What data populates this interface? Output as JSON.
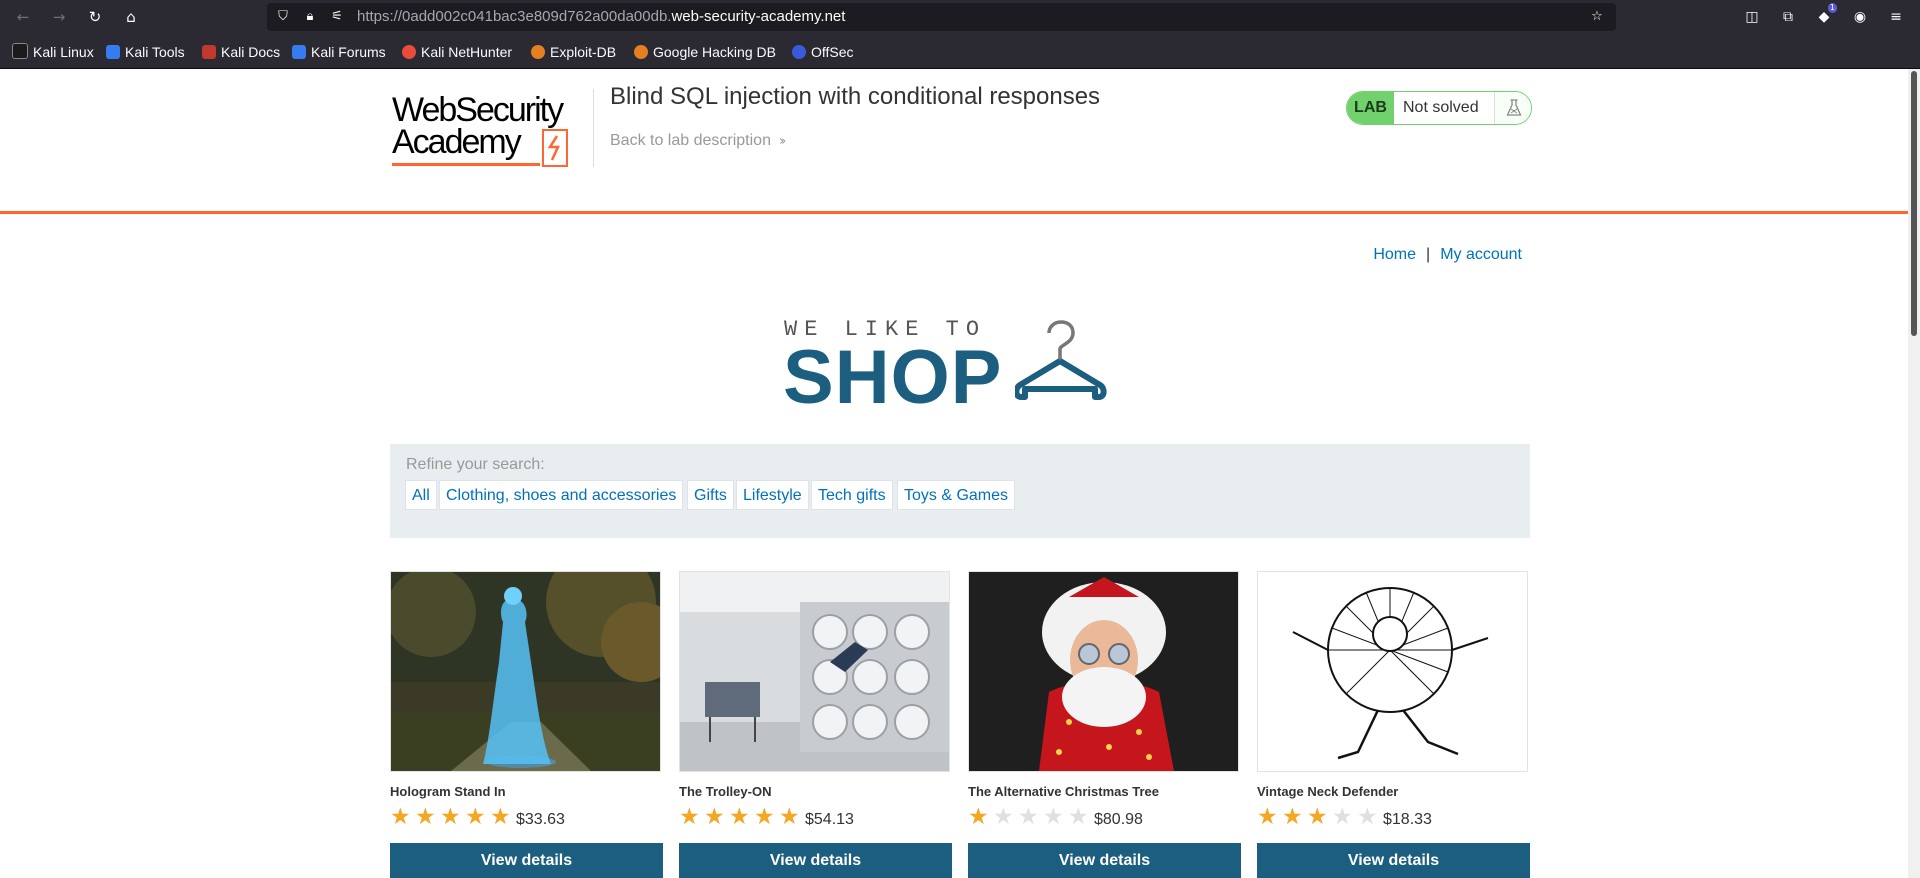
{
  "browser": {
    "url_prefix": "https://0add002c041bac3e809d762a00da00db.",
    "url_domain": "web-security-academy.net",
    "extension_badge": "1",
    "bookmarks": [
      {
        "label": "Kali Linux",
        "color": "#1b1b1b"
      },
      {
        "label": "Kali Tools",
        "color": "#367bf0"
      },
      {
        "label": "Kali Docs",
        "color": "#c0392b"
      },
      {
        "label": "Kali Forums",
        "color": "#367bf0"
      },
      {
        "label": "Kali NetHunter",
        "color": "#e74c3c"
      },
      {
        "label": "Exploit-DB",
        "color": "#e67e22"
      },
      {
        "label": "Google Hacking DB",
        "color": "#e67e22"
      },
      {
        "label": "OffSec",
        "color": "#3a5bd9"
      }
    ]
  },
  "lab": {
    "logo_line1": "WebSecurity",
    "logo_line2": "Academy",
    "title": "Blind SQL injection with conditional responses",
    "back_link": "Back to lab description",
    "status_tag": "LAB",
    "status_text": "Not solved"
  },
  "nav": {
    "home": "Home",
    "separator": "|",
    "my_account": "My account"
  },
  "banner": {
    "tagline": "WE LIKE TO",
    "word": "SHOP"
  },
  "filter": {
    "label": "Refine your search:",
    "categories": [
      "All",
      "Clothing, shoes and accessories",
      "Gifts",
      "Lifestyle",
      "Tech gifts",
      "Toys & Games"
    ]
  },
  "products": [
    {
      "name": "Hologram Stand In",
      "rating": 5,
      "price": "$33.63",
      "button": "View details"
    },
    {
      "name": "The Trolley-ON",
      "rating": 5,
      "price": "$54.13",
      "button": "View details"
    },
    {
      "name": "The Alternative Christmas Tree",
      "rating": 1,
      "price": "$80.98",
      "button": "View details"
    },
    {
      "name": "Vintage Neck Defender",
      "rating": 3,
      "price": "$18.33",
      "button": "View details"
    }
  ],
  "colors": {
    "accent_orange": "#ff6633",
    "brand_blue": "#1b5e7f",
    "link_blue": "#0071bc",
    "lab_green": "#70d16d",
    "star_gold": "#f5a623",
    "star_empty": "#e0e0e0"
  }
}
